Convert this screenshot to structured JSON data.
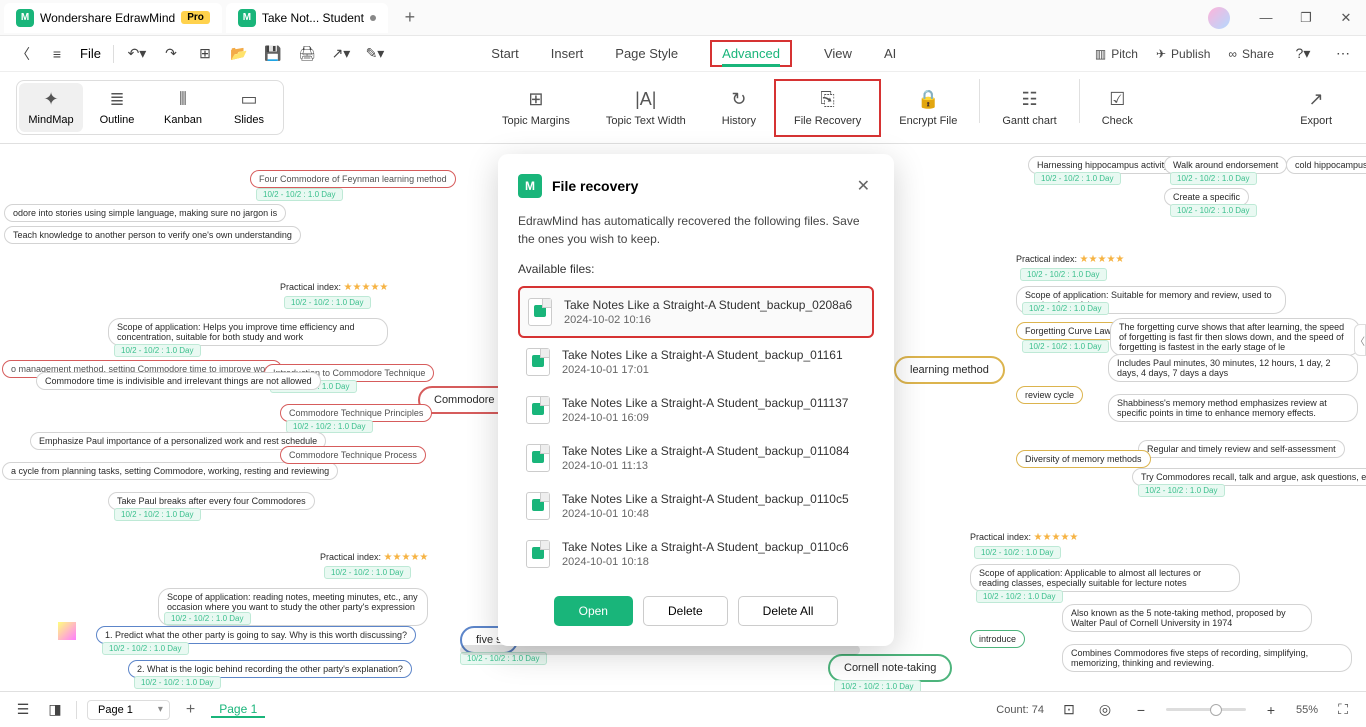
{
  "titlebar": {
    "app_name": "Wondershare EdrawMind",
    "pro": "Pro",
    "file_tab": "Take Not... Student"
  },
  "toolbar": {
    "file": "File",
    "menu": {
      "start": "Start",
      "insert": "Insert",
      "page_style": "Page Style",
      "advanced": "Advanced",
      "view": "View",
      "ai": "AI"
    },
    "right": {
      "pitch": "Pitch",
      "publish": "Publish",
      "share": "Share"
    }
  },
  "ribbon": {
    "views": {
      "mindmap": "MindMap",
      "outline": "Outline",
      "kanban": "Kanban",
      "slides": "Slides"
    },
    "topic_margins": "Topic Margins",
    "topic_text_width": "Topic Text Width",
    "history": "History",
    "file_recovery": "File Recovery",
    "encrypt_file": "Encrypt File",
    "gantt_chart": "Gantt chart",
    "check": "Check",
    "export": "Export"
  },
  "modal": {
    "title": "File recovery",
    "desc": "EdrawMind has automatically recovered the following files. Save the ones you wish to keep.",
    "available": "Available files:",
    "files": [
      {
        "name": "Take Notes Like a Straight-A Student_backup_0208a6",
        "date": "2024-10-02 10:16"
      },
      {
        "name": "Take Notes Like a Straight-A Student_backup_01161",
        "date": "2024-10-01 17:01"
      },
      {
        "name": "Take Notes Like a Straight-A Student_backup_011137",
        "date": "2024-10-01 16:09"
      },
      {
        "name": "Take Notes Like a Straight-A Student_backup_011084",
        "date": "2024-10-01 11:13"
      },
      {
        "name": "Take Notes Like a Straight-A Student_backup_0110c5",
        "date": "2024-10-01 10:48"
      },
      {
        "name": "Take Notes Like a Straight-A Student_backup_0110c6",
        "date": "2024-10-01 10:18"
      }
    ],
    "open": "Open",
    "delete": "Delete",
    "delete_all": "Delete All"
  },
  "canvas": {
    "commodore": "Commodore le",
    "learning_method": "learning method",
    "cornell": "Cornell note-taking",
    "five_s": "five s",
    "practical_index": "Practical index:",
    "nodes_left": [
      "Four Commodore of Feynman learning method",
      "odore into stories using simple language, making sure no jargon is",
      "Teach knowledge to another person to verify one's own understanding",
      "Scope of application: Helps you improve time efficiency and concentration, suitable for both study and work",
      "o management method, setting Commodore time to improve work",
      "Introduction to Commodore Technique",
      "Commodore time is indivisible and irrelevant things are not allowed",
      "Commodore Technique Principles",
      "Emphasize Paul importance of a personalized work and rest schedule",
      "a cycle from planning tasks, setting Commodore, working, resting and reviewing",
      "Commodore Technique Process",
      "Take Paul breaks after every four Commodores",
      "Scope of application: reading notes, meeting minutes, etc., any occasion where you want to study the other party's expression logic and content.",
      "1. Predict what the other party is going to say. Why is this worth discussing?",
      "2. What is the logic behind recording the other party's explanation?"
    ],
    "nodes_right": [
      "Harnessing hippocampus activity",
      "Walk around endorsement",
      "cold hippocampus",
      "Create a specific",
      "Scope of application: Suitable for memory and review, used to combat forgetfulness",
      "Forgetting Curve Law",
      "The forgetting curve shows that after learning, the speed of forgetting is fast fir then slows down, and the speed of forgetting is fastest in the early stage of le",
      "Includes Paul minutes, 30 minutes, 12 hours, 1 day, 2 days, 4 days, 7 days a days",
      "review cycle",
      "Shabbiness's memory method emphasizes review at specific points in time to enhance memory effects.",
      "Regular and timely review and self-assessment",
      "Diversity of memory methods",
      "Try Commodores recall, talk and argue, ask questions, etc.",
      "Scope of application: Applicable to almost all lectures or reading classes, especially suitable for lecture notes",
      "Also known as the 5 note-taking method, proposed by Walter Paul of Cornell University in 1974",
      "introduce",
      "Combines Commodores five steps of recording, simplifying, memorizing, thinking and reviewing."
    ],
    "date_tag": "10/2 - 10/2 : 1.0 Day"
  },
  "statusbar": {
    "page_sel": "Page 1",
    "page_tab": "Page 1",
    "count": "Count: 74",
    "zoom": "55%"
  }
}
